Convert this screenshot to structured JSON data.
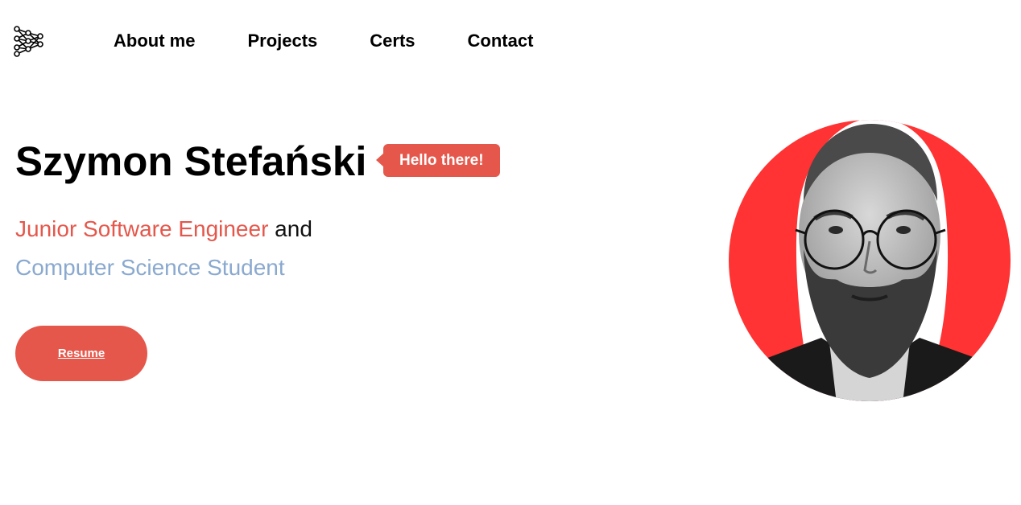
{
  "header": {
    "logo_icon": "neural-network-icon",
    "nav": [
      {
        "label": "About me"
      },
      {
        "label": "Projects"
      },
      {
        "label": "Certs"
      },
      {
        "label": "Contact"
      }
    ]
  },
  "hero": {
    "name": "Szymon Stefański",
    "badge": "Hello there!",
    "role": "Junior Software Engineer",
    "connector": " and",
    "status": "Computer Science Student",
    "resume_label": "Resume"
  },
  "colors": {
    "accent_red": "#e5574b",
    "accent_blue": "#8aa9cf",
    "avatar_background": "#ff3333"
  }
}
